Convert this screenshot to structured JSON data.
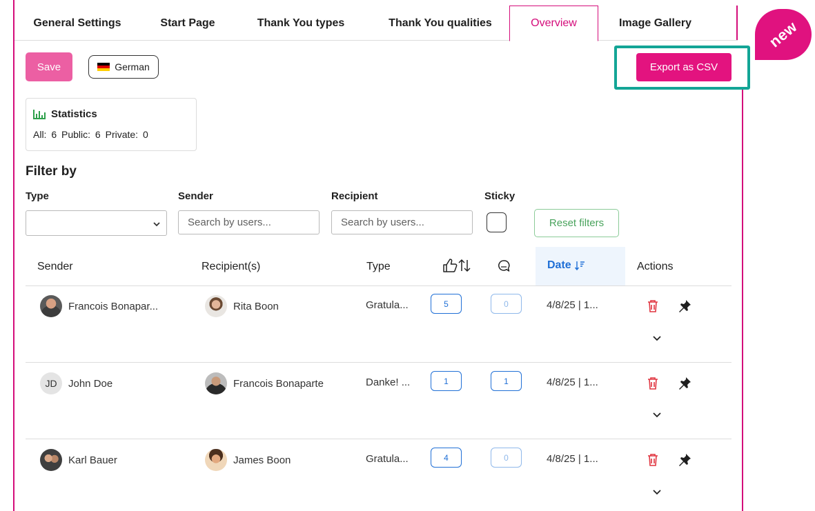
{
  "tabs": [
    {
      "label": "General Settings",
      "active": false
    },
    {
      "label": "Start Page",
      "active": false
    },
    {
      "label": "Thank You types",
      "active": false
    },
    {
      "label": "Thank You qualities",
      "active": false
    },
    {
      "label": "Overview",
      "active": true
    },
    {
      "label": "Image Gallery",
      "active": false
    }
  ],
  "badge": {
    "label": "new",
    "color": "#e0127f"
  },
  "toolbar": {
    "save_label": "Save",
    "language_label": "German",
    "language_icon": "german-flag-icon",
    "export_label": "Export as CSV"
  },
  "statistics": {
    "title": "Statistics",
    "icon": "bar-chart-icon",
    "all": "All: 6",
    "public": "Public: 6",
    "private": "Private: 0"
  },
  "filter": {
    "title": "Filter by",
    "type_label": "Type",
    "type_value": "",
    "sender_label": "Sender",
    "sender_placeholder": "Search by users...",
    "recipient_label": "Recipient",
    "recipient_placeholder": "Search by users...",
    "sticky_label": "Sticky",
    "sticky_checked": false,
    "reset_label": "Reset filters"
  },
  "table": {
    "columns": {
      "sender": "Sender",
      "recipients": "Recipient(s)",
      "type": "Type",
      "likes_icon": "thumbs-up-sort-icon",
      "comments_icon": "comment-icon",
      "date": "Date",
      "actions": "Actions"
    },
    "rows": [
      {
        "sender": "Francois Bonapar...",
        "recipient": "Rita Boon",
        "type": "Gratula...",
        "likes": "5",
        "comments": "0",
        "date": "4/8/25 | 1..."
      },
      {
        "sender": "John Doe",
        "sender_initials": "JD",
        "recipient": "Francois Bonaparte",
        "type": "Danke! ...",
        "likes": "1",
        "comments": "1",
        "date": "4/8/25 | 1..."
      },
      {
        "sender": "Karl Bauer",
        "recipient": "James Boon",
        "type": "Gratula...",
        "likes": "4",
        "comments": "0",
        "date": "4/8/25 | 1..."
      }
    ]
  },
  "colors": {
    "brand": "#e3137f",
    "highlight": "#13a596",
    "link_blue": "#1f6fd6",
    "reset_green": "#49a35c",
    "delete_red": "#e0343f"
  }
}
